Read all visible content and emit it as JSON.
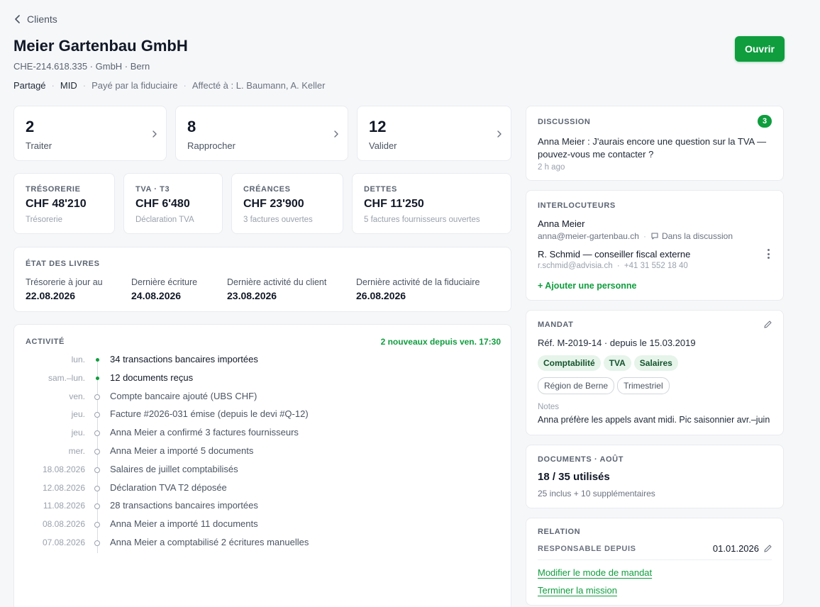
{
  "header": {
    "back_label": "Clients",
    "title": "Meier Gartenbau GmbH",
    "subtitle": "CHE-214.618.335 · GmbH · Bern",
    "meta": [
      "Partagé",
      "MID",
      "Payé par la fiduciaire",
      "Affecté à : L. Baumann, A. Keller"
    ],
    "open_button": "Ouvrir"
  },
  "tasks": [
    {
      "count": "2",
      "label": "Traiter"
    },
    {
      "count": "8",
      "label": "Rapprocher"
    },
    {
      "count": "12",
      "label": "Valider"
    }
  ],
  "kpis": [
    {
      "caption": "TRÉSORERIE",
      "value": "CHF 48'210",
      "sub": "Trésorerie"
    },
    {
      "caption": "TVA · T3",
      "value": "CHF 6'480",
      "sub": "Déclaration TVA"
    },
    {
      "caption": "CRÉANCES",
      "value": "CHF 23'900",
      "sub": "3 factures ouvertes"
    },
    {
      "caption": "DETTES",
      "value": "CHF 11'250",
      "sub": "5 factures fournisseurs ouvertes"
    }
  ],
  "books": {
    "title": "ÉTAT DES LIVRES",
    "items": [
      {
        "label": "Trésorerie à jour au",
        "value": "22.08.2026"
      },
      {
        "label": "Dernière écriture",
        "value": "24.08.2026"
      },
      {
        "label": "Dernière activité du client",
        "value": "23.08.2026"
      },
      {
        "label": "Dernière activité de la fiduciaire",
        "value": "26.08.2026"
      }
    ]
  },
  "activity": {
    "title": "ACTIVITÉ",
    "new_label": "2 nouveaux depuis ven. 17:30",
    "items": [
      {
        "when": "lun.",
        "text": "34 transactions bancaires importées",
        "new": true
      },
      {
        "when": "sam.–lun.",
        "text": "12 documents reçus",
        "new": true
      },
      {
        "when": "ven.",
        "text": "Compte bancaire ajouté (UBS CHF)",
        "new": false
      },
      {
        "when": "jeu.",
        "text": "Facture #2026-031 émise (depuis le devi #Q-12)",
        "new": false
      },
      {
        "when": "jeu.",
        "text": "Anna Meier a confirmé 3 factures fournisseurs",
        "new": false
      },
      {
        "when": "mer.",
        "text": "Anna Meier a importé 5 documents",
        "new": false
      },
      {
        "when": "18.08.2026",
        "text": "Salaires de juillet comptabilisés",
        "new": false
      },
      {
        "when": "12.08.2026",
        "text": "Déclaration TVA T2 déposée",
        "new": false
      },
      {
        "when": "11.08.2026",
        "text": "28 transactions bancaires importées",
        "new": false
      },
      {
        "when": "08.08.2026",
        "text": "Anna Meier a importé 11 documents",
        "new": false
      },
      {
        "when": "07.08.2026",
        "text": "Anna Meier a comptabilisé 2 écritures manuelles",
        "new": false
      }
    ]
  },
  "discussion": {
    "title": "DISCUSSION",
    "count": "3",
    "message": "Anna Meier : J'aurais encore une question sur la TVA — pouvez-vous me contacter ?",
    "time": "2 h ago"
  },
  "contacts": {
    "title": "INTERLOCUTEURS",
    "people": [
      {
        "name": "Anna Meier",
        "email": "anna@meier-gartenbau.ch",
        "extra": "Dans la discussion"
      },
      {
        "name": "R. Schmid — conseiller fiscal externe",
        "email": "r.schmid@advisia.ch",
        "extra": "+41 31 552 18 40"
      }
    ],
    "add_label": "+ Ajouter une personne"
  },
  "mandate": {
    "title": "MANDAT",
    "ref": "Réf. M-2019-14 · depuis le 15.03.2019",
    "tags_primary": [
      "Comptabilité",
      "TVA",
      "Salaires"
    ],
    "tags_secondary": [
      "Région de Berne",
      "Trimestriel"
    ],
    "notes_label": "Notes",
    "notes": "Anna préfère les appels avant midi. Pic saisonnier avr.–juin"
  },
  "documents": {
    "title": "DOCUMENTS · AOÛT",
    "usage": "18 / 35 utilisés",
    "detail": "25 inclus + 10 supplémentaires"
  },
  "relation": {
    "title": "RELATION",
    "since_label": "RESPONSABLE DEPUIS",
    "since_value": "01.01.2026",
    "link_modify": "Modifier le mode de mandat",
    "link_end": "Terminer la mission"
  },
  "colors": {
    "accent": "#0f9d3e",
    "background": "#f6f7f9"
  }
}
